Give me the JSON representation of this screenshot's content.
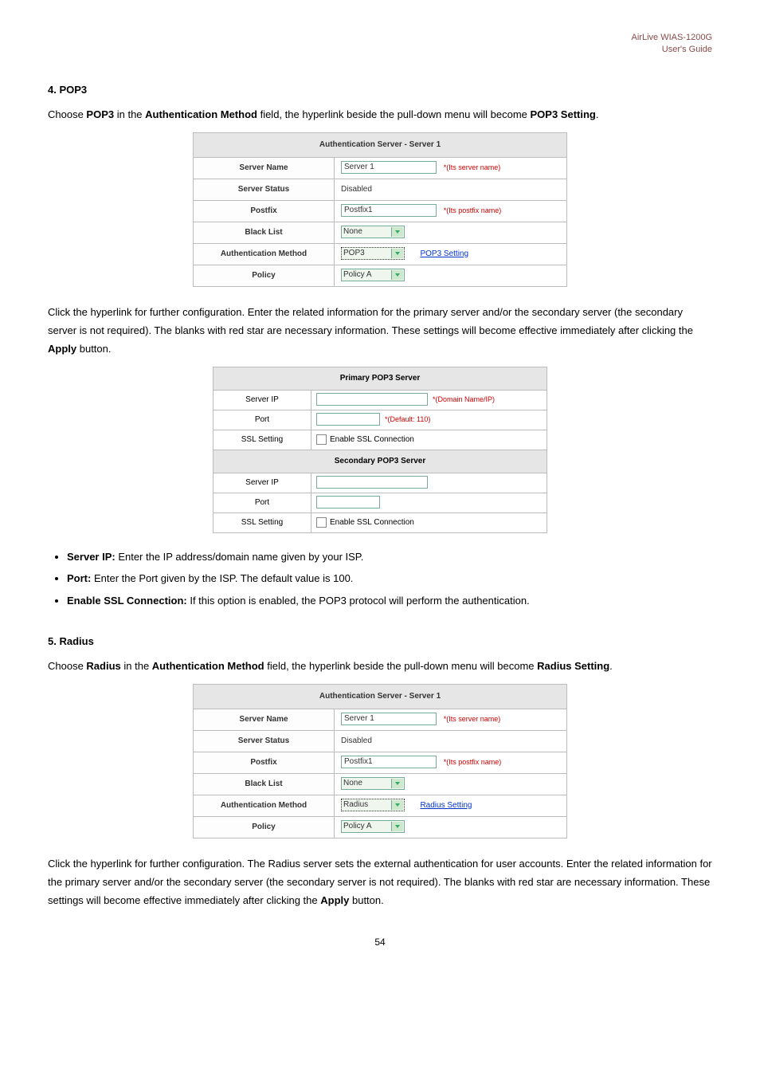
{
  "header": {
    "line1": "AirLive WIAS-1200G",
    "line2": "User's Guide"
  },
  "section_pop3": {
    "num": "4. POP3",
    "intro_pre": "Choose ",
    "intro_bold1": "POP3",
    "intro_mid1": " in the ",
    "intro_bold2": "Authentication Method",
    "intro_mid2": " field, the hyperlink beside the pull-down menu will become ",
    "intro_end_bold": "POP3 Setting",
    "para2": "Click the hyperlink for further configuration. Enter the related information for the primary server and/or the secondary server (the secondary server is not required). The blanks with red star are necessary information. These settings will become effective immediately after clicking the ",
    "apply_bold": "Apply",
    "button_word": " button."
  },
  "auth_table_pop3": {
    "title": "Authentication Server - Server 1",
    "rows": {
      "server_name_label": "Server Name",
      "server_name_value": "Server 1",
      "server_name_note": "*(Its server name)",
      "server_status_label": "Server Status",
      "server_status_value": "Disabled",
      "postfix_label": "Postfix",
      "postfix_value": "Postfix1",
      "postfix_note": "*(Its postfix name)",
      "blacklist_label": "Black List",
      "blacklist_value": "None",
      "auth_method_label": "Authentication Method",
      "auth_method_value": "POP3",
      "auth_method_link": "POP3 Setting",
      "policy_label": "Policy",
      "policy_value": "Policy A"
    }
  },
  "pop3_server_table": {
    "title1": "Primary POP3 Server",
    "title2": "Secondary POP3 Server",
    "server_ip_label": "Server IP",
    "server_ip_note": "*(Domain Name/IP)",
    "port_label": "Port",
    "port_note": "*(Default: 110)",
    "ssl_label": "SSL Setting",
    "ssl_text": "Enable SSL Connection"
  },
  "bullets_pop3": {
    "b1_bold": "Server IP:",
    "b1_text": " Enter the IP address/domain name given by your ISP.",
    "b2_bold": "Port:",
    "b2_text": " Enter the Port given by the ISP. The default value is 100.",
    "b3_bold": "Enable SSL Connection:",
    "b3_text": " If this option is enabled, the POP3 protocol will perform the authentication."
  },
  "section_radius": {
    "num": "5. Radius",
    "intro_pre": "Choose ",
    "intro_bold1": "Radius",
    "intro_mid1": " in the ",
    "intro_bold2": "Authentication Method",
    "intro_mid2": " field, the hyperlink beside the pull-down menu will become ",
    "intro_end_bold": "Radius Setting",
    "para2": "Click the hyperlink for further configuration. The Radius server sets the external authentication for user accounts. Enter the related information for the primary server and/or the secondary server (the secondary server is not required). The blanks with red star are necessary information. These settings will become effective immediately after clicking the ",
    "apply_bold": "Apply",
    "button_word": " button."
  },
  "auth_table_radius": {
    "title": "Authentication Server - Server 1",
    "rows": {
      "auth_method_value": "Radius",
      "auth_method_link": "Radius Setting"
    }
  },
  "page_no": "54"
}
